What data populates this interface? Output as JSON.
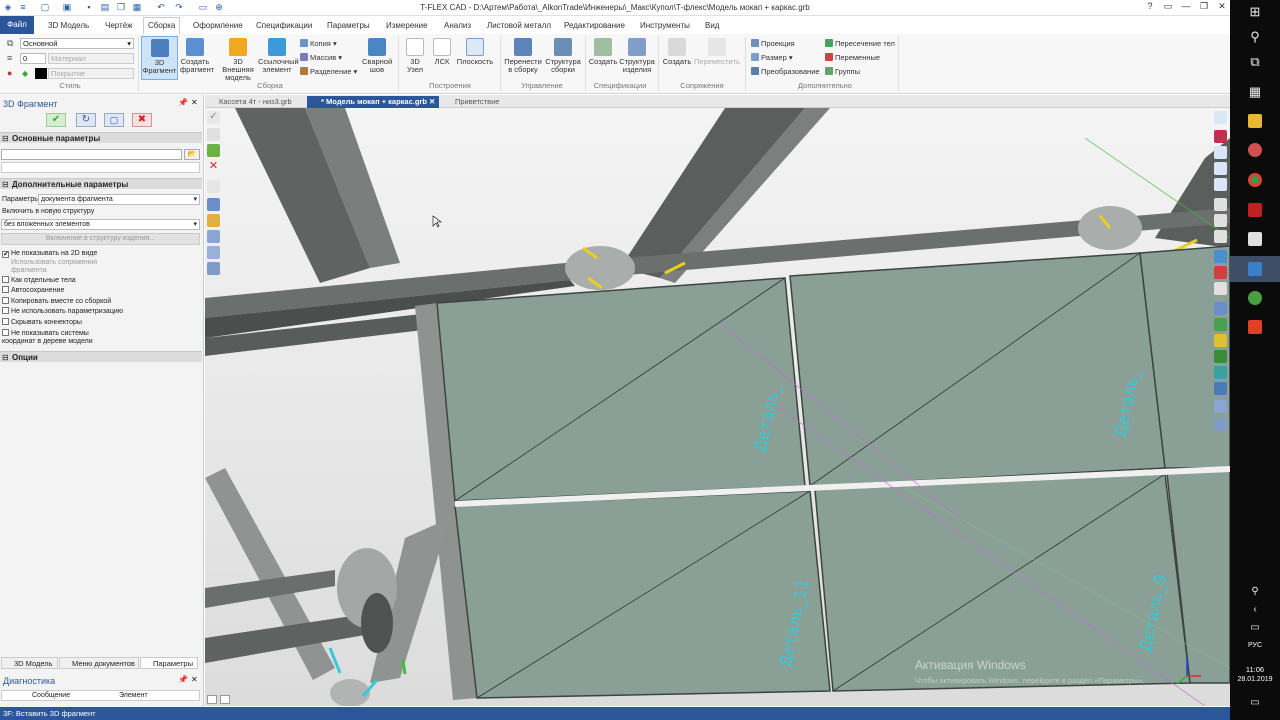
{
  "window": {
    "title": "T-FLEX CAD - D:\\Артем\\Работа\\_AlkonTrade\\Инженеры\\_Макс\\Купол\\Т-флекс\\Модель мокап + каркас.grb"
  },
  "menu": {
    "file": "Файл",
    "items": [
      "3D Модель",
      "Чертёж",
      "Сборка",
      "Оформление",
      "Спецификации",
      "Параметры",
      "Измерение",
      "Анализ",
      "Листовой металл",
      "Редактирование",
      "Инструменты",
      "Вид"
    ],
    "active": "Сборка"
  },
  "ribbon": {
    "style": {
      "layer_value": "Основной",
      "line_value": "0",
      "material_placeholder": "Материал",
      "cover_placeholder": "Покрытие",
      "group_label": "Стиль"
    },
    "assembly": {
      "fragment3d": "3D Фрагмент",
      "create_fragment": "Создать фрагмент",
      "external_3d_model": "3D Внешняя модель",
      "ref_element": "Ссылочный элемент",
      "copy": "Копия",
      "array": "Массив",
      "split": "Разделение",
      "weld": "Сварной шов",
      "group_label": "Сборка"
    },
    "construct": {
      "node3d": "3D Узел",
      "lcs": "ЛСК",
      "plane": "Плоскость",
      "group_label": "Построения"
    },
    "manage": {
      "move_to_assembly": "Перенести в сборку",
      "assembly_structure": "Структура сборки",
      "group_label": "Управление"
    },
    "specs": {
      "create": "Создать",
      "product_structure": "Структура изделия",
      "group_label": "Спецификации"
    },
    "mates": {
      "create": "Создать",
      "move": "Переместить",
      "group_label": "Сопряжения"
    },
    "extra": {
      "projection": "Проекция",
      "size": "Размер",
      "transform": "Преобразование",
      "body_intersection": "Пересечение тел",
      "variables": "Переменные",
      "groups": "Группы",
      "group_label": "Дополнительно"
    }
  },
  "panel": {
    "title": "3D Фрагмент",
    "main_params": "Основные параметры",
    "extra_params": "Дополнительные параметры",
    "params_label": "Параметры",
    "params_value": "документа фрагмента",
    "include_label": "Включить в новую структуру",
    "include_value": "без вложенных элементов",
    "include_button": "Включение в структуру изделия...",
    "options": [
      {
        "label": "Не показывать на 2D виде",
        "checked": true
      },
      {
        "label": "Использовать сопряжения фрагмента",
        "checked": false,
        "disabled": true
      },
      {
        "label": "Как отдельные тела",
        "checked": false
      },
      {
        "label": "Автосохранение",
        "checked": false
      },
      {
        "label": "Копировать вместе со сборкой",
        "checked": false
      },
      {
        "label": "Не использовать параметризацию",
        "checked": false
      },
      {
        "label": "Скрывать коннекторы",
        "checked": false
      },
      {
        "label": "Не показывать системы координат в дереве модели",
        "checked": false
      }
    ],
    "options_section": "Опции",
    "bottom_tabs": [
      "3D Модель",
      "Меню документов",
      "Параметры"
    ],
    "diagnostics": "Диагностика",
    "diag_columns": [
      "Сообщение",
      "Элемент"
    ]
  },
  "doc_tabs": [
    {
      "label": "Кассета 4т - низ3.grb",
      "active": false
    },
    {
      "label": "* Модель мокап + каркас.grb",
      "active": true
    },
    {
      "label": "Приветствие",
      "active": false
    }
  ],
  "viewport": {
    "part_labels": [
      "Деталь_",
      "Деталь_",
      "Деталь_11",
      "Деталь_9"
    ],
    "watermark_title": "Активация Windows",
    "watermark_sub": "Чтобы активировать Windows, перейдите в раздел «Параметры»."
  },
  "status": {
    "text": "3F: Вставить 3D фрагмент"
  },
  "taskbar": {
    "lang": "РУС",
    "time": "11:06",
    "date": "28.01.2019"
  },
  "colors": {
    "accent": "#2b579a",
    "panel_fill": "#8a9f96",
    "beam": "#5c5f5e",
    "label": "#38c8d8"
  }
}
